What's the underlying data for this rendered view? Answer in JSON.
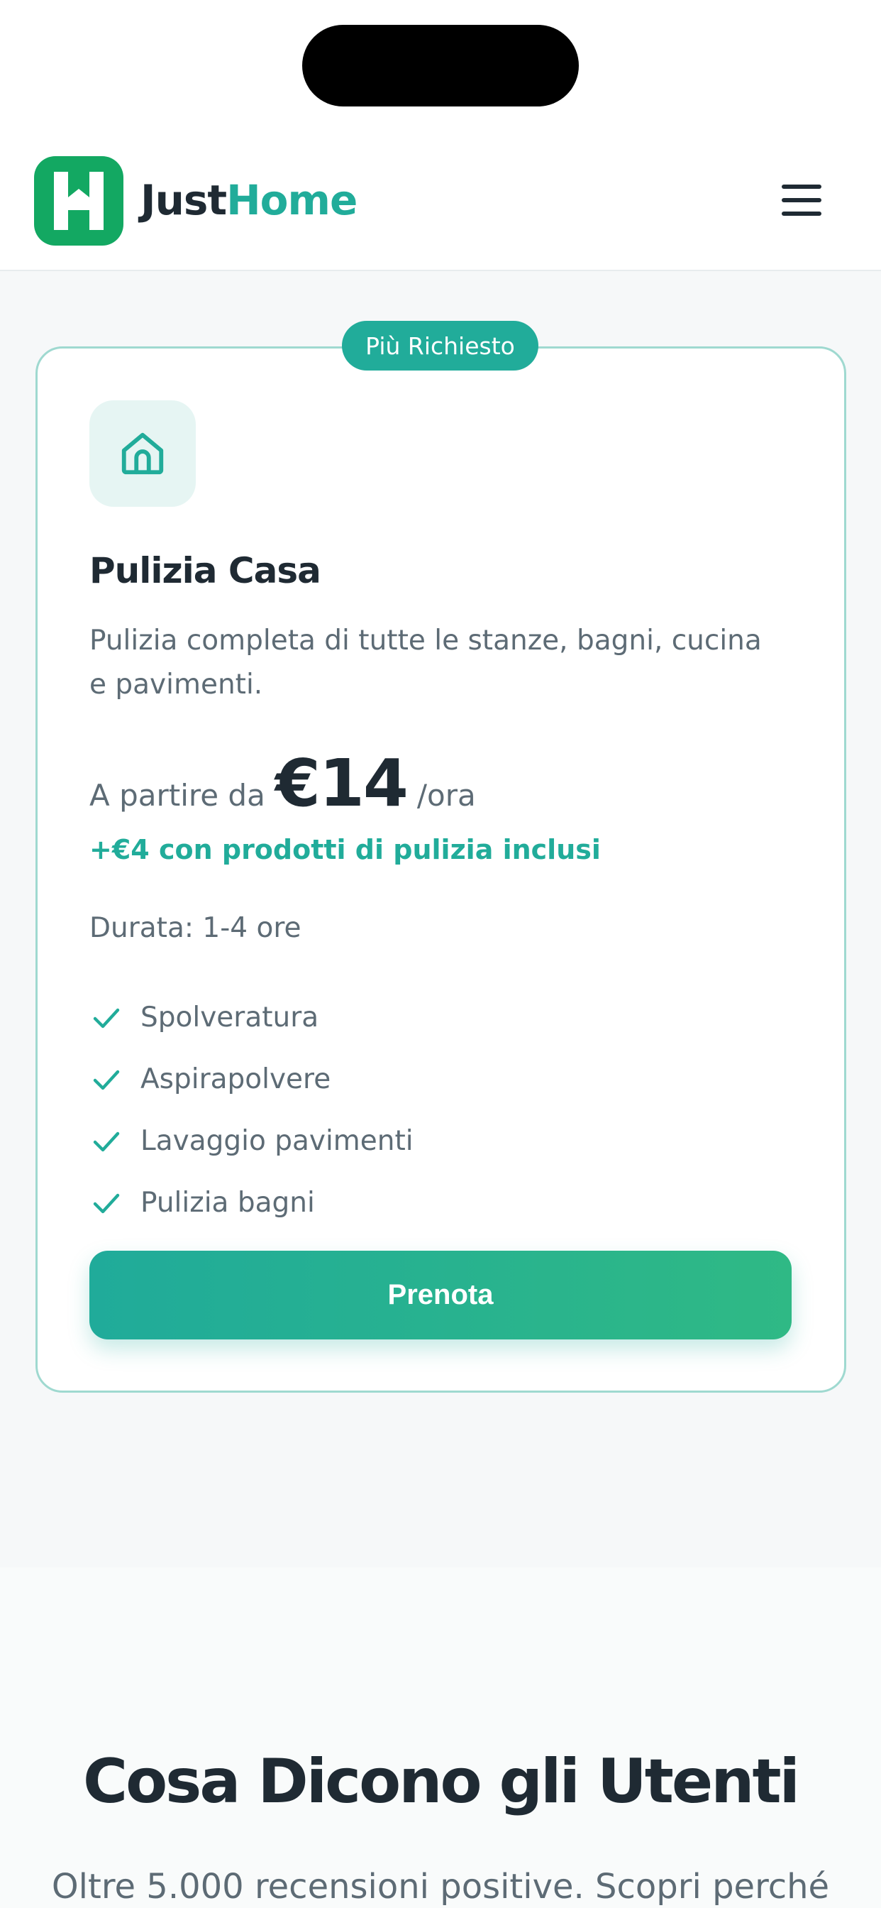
{
  "brand": {
    "name_part1": "Just",
    "name_part2": "Home"
  },
  "colors": {
    "accent": "#21ac9a",
    "logo_green": "#13a862",
    "text_dark": "#1f2a33",
    "text_muted": "#5d6b75"
  },
  "service": {
    "badge": "Più Richiesto",
    "icon": "home-icon",
    "title": "Pulizia Casa",
    "description": "Pulizia completa di tutte le stanze, bagni, cucina e pavimenti.",
    "price_prefix": "A partire da",
    "price": "€14",
    "price_unit": "/ora",
    "extra": "+€4 con prodotti di pulizia inclusi",
    "duration": "Durata: 1-4 ore",
    "features": [
      "Spolveratura",
      "Aspirapolvere",
      "Lavaggio pavimenti",
      "Pulizia bagni"
    ],
    "cta": "Prenota"
  },
  "testimonials": {
    "title": "Cosa Dicono gli Utenti",
    "subtitle": "Oltre 5.000 recensioni positive. Scopri perché"
  }
}
